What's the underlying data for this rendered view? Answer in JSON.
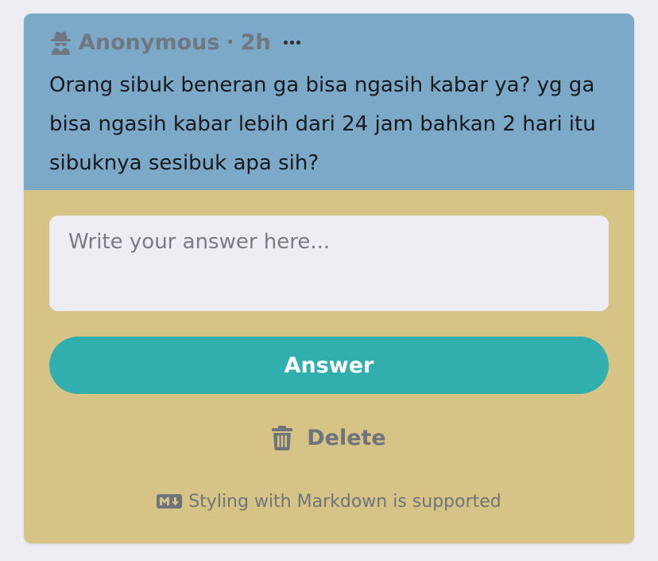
{
  "question": {
    "author": "Anonymous",
    "separator": "·",
    "time": "2h",
    "text": "Orang sibuk beneran ga bisa ngasih kabar ya? yg ga bisa ngasih kabar lebih dari 24 jam bahkan 2 hari itu sibuknya sesibuk apa sih?",
    "author_icon": "spy-icon",
    "menu_icon": "more-horizontal-icon"
  },
  "answer": {
    "placeholder": "Write your answer here...",
    "value": "",
    "submit_label": "Answer"
  },
  "actions": {
    "delete_label": "Delete",
    "delete_icon": "trash-icon"
  },
  "footer": {
    "markdown_note": "Styling with Markdown is supported",
    "markdown_icon": "markdown-icon"
  },
  "colors": {
    "page_background": "#efedf4",
    "question_background": "#7ca9c8",
    "card_background": "#d5c485",
    "accent_button": "#31aeae",
    "muted_text": "#6f747a"
  }
}
